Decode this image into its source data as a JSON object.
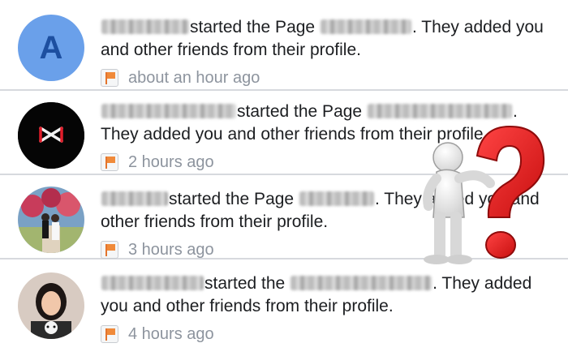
{
  "notifications": [
    {
      "avatar_letter": "A",
      "text_part1": "started the Page",
      "text_part2": ". They added you and other friends from their profile.",
      "time": "about an hour ago"
    },
    {
      "avatar_letter": "",
      "text_part1": "started the Page",
      "text_part2": ". They added you and other friends from their profile.",
      "time": "2 hours ago"
    },
    {
      "avatar_letter": "",
      "text_part1": "started the Page",
      "text_part2": ". They added you and other friends from their profile.",
      "time": "3 hours ago"
    },
    {
      "avatar_letter": "",
      "text_part1": "started the",
      "text_part2": ". They added you and other friends from their profile.",
      "time": "4 hours ago"
    }
  ],
  "colors": {
    "avatar_1_bg": "#6aa0ea",
    "avatar_2_bg": "#050505",
    "time_text": "#8d949e",
    "question_mark": "#e31e1e"
  },
  "icons": [
    "page-flag-icon",
    "question-mascot-icon"
  ]
}
